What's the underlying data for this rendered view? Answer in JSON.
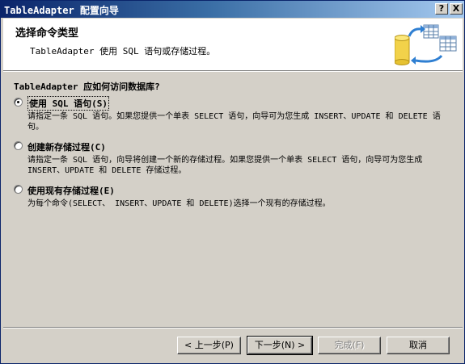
{
  "window": {
    "title": "TableAdapter 配置向导",
    "help_button": "?",
    "close_button": "X"
  },
  "header": {
    "title": "选择命令类型",
    "subtitle": "TableAdapter 使用 SQL 语句或存储过程。"
  },
  "question": "TableAdapter 应如何访问数据库?",
  "options": [
    {
      "label": "使用 SQL 语句(S)",
      "selected": true,
      "description": "请指定一条 SQL 语句。如果您提供一个单表 SELECT 语句，向导可为您生成 INSERT、UPDATE 和 DELETE 语句。"
    },
    {
      "label": "创建新存储过程(C)",
      "selected": false,
      "description": "请指定一条 SQL 语句，向导将创建一个新的存储过程。如果您提供一个单表 SELECT 语句，向导可为您生成 INSERT、UPDATE 和 DELETE 存储过程。"
    },
    {
      "label": "使用现有存储过程(E)",
      "selected": false,
      "description": "为每个命令(SELECT、 INSERT、UPDATE 和 DELETE)选择一个现有的存储过程。"
    }
  ],
  "buttons": {
    "previous": "< 上一步(P)",
    "next": "下一步(N) >",
    "finish": "完成(F)",
    "cancel": "取消"
  },
  "colors": {
    "title_gradient_start": "#0a246a",
    "title_gradient_end": "#a6caf0",
    "dialog_face": "#d4d0c8"
  },
  "icons": {
    "header": "database-table-sync-icon"
  }
}
